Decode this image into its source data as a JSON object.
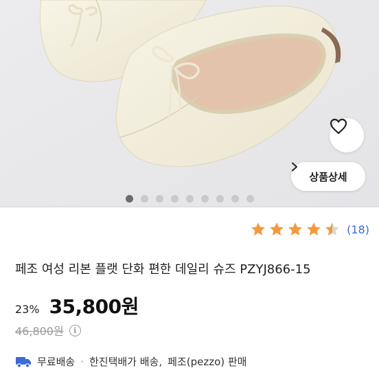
{
  "hero": {
    "detail_button_label": "상품상세",
    "slide_count": 9,
    "active_slide": 0
  },
  "rating": {
    "stars": 4.5,
    "max": 5,
    "count_text": "(18)",
    "star_color": "#f39a3d"
  },
  "product": {
    "title": "페조 여성 리본 플랫 단화 편한 데일리 슈즈 PZYJ866-15",
    "discount": "23%",
    "price": "35,800원",
    "original_price": "46,800원"
  },
  "shipping": {
    "free": "무료배송",
    "separator": "·",
    "carrier": "한진택배가 배송,",
    "seller": "페조(pezzo) 판매",
    "truck_color": "#3b6ad9"
  },
  "icons": [
    "heart-icon",
    "chevron-right-icon",
    "star-icon",
    "info-icon",
    "truck-icon"
  ]
}
